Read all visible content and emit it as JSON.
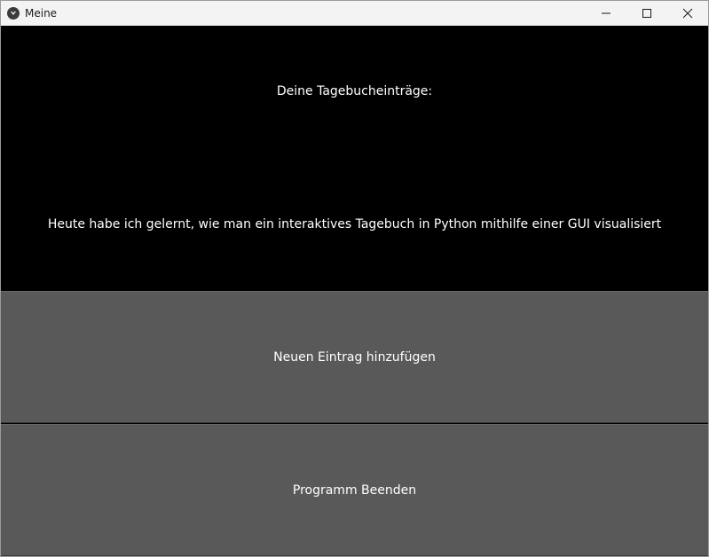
{
  "window": {
    "title": "Meine",
    "icon": "kivy-app-icon",
    "controls": [
      "minimize-icon",
      "maximize-icon",
      "close-icon"
    ]
  },
  "main": {
    "heading": "Deine Tagebucheinträge:",
    "entry_text": "Heute habe ich gelernt, wie man ein interaktives Tagebuch in Python mithilfe einer GUI visualisiert"
  },
  "buttons": {
    "add_label": "Neuen Eintrag hinzufügen",
    "exit_label": "Programm Beenden"
  },
  "colors": {
    "background": "#000000",
    "button": "#595959",
    "text": "#ffffff",
    "titlebar": "#f3f3f3"
  }
}
